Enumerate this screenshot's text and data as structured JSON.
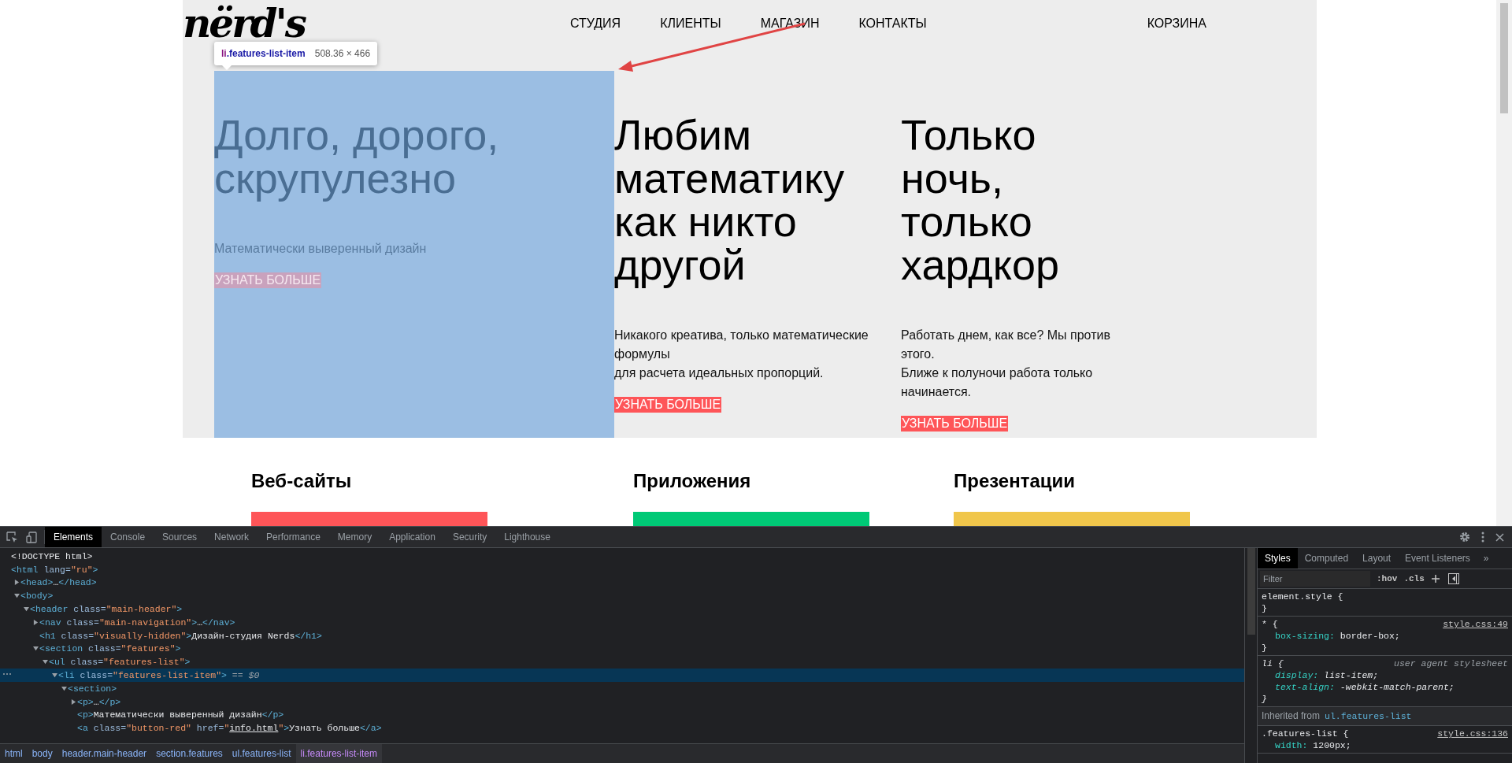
{
  "page": {
    "logo": "nërd's",
    "nav": [
      {
        "label": "СТУДИЯ"
      },
      {
        "label": "КЛИЕНТЫ"
      },
      {
        "label": "МАГАЗИН"
      },
      {
        "label": "КОНТАКТЫ"
      }
    ],
    "cart": "КОРЗИНА",
    "inspect_tooltip": {
      "tag": "li",
      "class_name": ".features-list-item",
      "size": "508.36 × 466"
    },
    "features": [
      {
        "title": "Долго, дорого, скрупулезно",
        "text": "Математически выверенный дизайн",
        "button": "УЗНАТЬ БОЛЬШЕ",
        "highlighted": true
      },
      {
        "title": "Любим математику как никто другой",
        "text": "Никакого креатива, только математические формулы\nдля расчета идеальных пропорций.",
        "button": "УЗНАТЬ БОЛЬШЕ",
        "highlighted": false
      },
      {
        "title": "Только ночь, только хардкор",
        "text": "Работать днем, как все? Мы против этого.\nБлиже к полуночи работа только начинается.",
        "button": "УЗНАТЬ БОЛЬШЕ",
        "highlighted": false
      }
    ],
    "services": [
      {
        "title": "Веб-сайты",
        "color": "#fe5558"
      },
      {
        "title": "Приложения",
        "color": "#00c976"
      },
      {
        "title": "Презентации",
        "color": "#f0c64b"
      }
    ]
  },
  "devtools": {
    "tabs": [
      {
        "label": "Elements",
        "selected": true
      },
      {
        "label": "Console",
        "selected": false
      },
      {
        "label": "Sources",
        "selected": false
      },
      {
        "label": "Network",
        "selected": false
      },
      {
        "label": "Performance",
        "selected": false
      },
      {
        "label": "Memory",
        "selected": false
      },
      {
        "label": "Application",
        "selected": false
      },
      {
        "label": "Security",
        "selected": false
      },
      {
        "label": "Lighthouse",
        "selected": false
      }
    ],
    "dom": [
      {
        "kind": "leaf",
        "selected": false,
        "tokens": [
          {
            "kind": "text",
            "text": "<!DOCTYPE html>"
          }
        ]
      },
      {
        "kind": "root",
        "selected": false,
        "tokens": [
          {
            "kind": "tag",
            "text": "<html"
          },
          {
            "kind": "attr",
            "text": " lang="
          },
          {
            "kind": "value",
            "text": "\"ru\""
          },
          {
            "kind": "tag",
            "text": ">"
          }
        ],
        "children": [
          {
            "kind": "branch",
            "expanded": false,
            "selected": false,
            "tokens": [
              {
                "kind": "tag",
                "text": "<head>"
              },
              {
                "kind": "text",
                "text": "…"
              },
              {
                "kind": "tag",
                "text": "</head>"
              }
            ]
          },
          {
            "kind": "branch",
            "expanded": true,
            "selected": false,
            "tokens": [
              {
                "kind": "tag",
                "text": "<body>"
              }
            ],
            "children": [
              {
                "kind": "branch",
                "expanded": true,
                "selected": false,
                "tokens": [
                  {
                    "kind": "tag",
                    "text": "<header"
                  },
                  {
                    "kind": "attr",
                    "text": " class="
                  },
                  {
                    "kind": "value",
                    "text": "\"main-header\""
                  },
                  {
                    "kind": "tag",
                    "text": ">"
                  }
                ],
                "children": [
                  {
                    "kind": "branch",
                    "expanded": false,
                    "selected": false,
                    "tokens": [
                      {
                        "kind": "tag",
                        "text": "<nav"
                      },
                      {
                        "kind": "attr",
                        "text": " class="
                      },
                      {
                        "kind": "value",
                        "text": "\"main-navigation\""
                      },
                      {
                        "kind": "tag",
                        "text": ">"
                      },
                      {
                        "kind": "text",
                        "text": "…"
                      },
                      {
                        "kind": "tag",
                        "text": "</nav>"
                      }
                    ]
                  },
                  {
                    "kind": "leaf",
                    "selected": false,
                    "tokens": [
                      {
                        "kind": "tag",
                        "text": "<h1"
                      },
                      {
                        "kind": "attr",
                        "text": " class="
                      },
                      {
                        "kind": "value",
                        "text": "\"visually-hidden\""
                      },
                      {
                        "kind": "tag",
                        "text": ">"
                      },
                      {
                        "kind": "text",
                        "text": "Дизайн-студия Nerds"
                      },
                      {
                        "kind": "tag",
                        "text": "</h1>"
                      }
                    ]
                  },
                  {
                    "kind": "branch",
                    "expanded": true,
                    "selected": false,
                    "tokens": [
                      {
                        "kind": "tag",
                        "text": "<section"
                      },
                      {
                        "kind": "attr",
                        "text": " class="
                      },
                      {
                        "kind": "value",
                        "text": "\"features\""
                      },
                      {
                        "kind": "tag",
                        "text": ">"
                      }
                    ],
                    "children": [
                      {
                        "kind": "branch",
                        "expanded": true,
                        "selected": false,
                        "tokens": [
                          {
                            "kind": "tag",
                            "text": "<ul"
                          },
                          {
                            "kind": "attr",
                            "text": " class="
                          },
                          {
                            "kind": "value",
                            "text": "\"features-list\""
                          },
                          {
                            "kind": "tag",
                            "text": ">"
                          }
                        ],
                        "children": [
                          {
                            "kind": "branch",
                            "expanded": true,
                            "selected": true,
                            "tokens": [
                              {
                                "kind": "tag",
                                "text": "<li"
                              },
                              {
                                "kind": "attr",
                                "text": " class="
                              },
                              {
                                "kind": "value",
                                "text": "\"features-list-item\""
                              },
                              {
                                "kind": "tag",
                                "text": ">"
                              },
                              {
                                "kind": "ref",
                                "text": " == $0"
                              }
                            ],
                            "children": [
                              {
                                "kind": "branch",
                                "expanded": true,
                                "selected": false,
                                "tokens": [
                                  {
                                    "kind": "tag",
                                    "text": "<section>"
                                  }
                                ],
                                "children": [
                                  {
                                    "kind": "branch",
                                    "expanded": false,
                                    "selected": false,
                                    "tokens": [
                                      {
                                        "kind": "tag",
                                        "text": "<p>"
                                      },
                                      {
                                        "kind": "text",
                                        "text": "…"
                                      },
                                      {
                                        "kind": "tag",
                                        "text": "</p>"
                                      }
                                    ]
                                  },
                                  {
                                    "kind": "leaf",
                                    "selected": false,
                                    "tokens": [
                                      {
                                        "kind": "tag",
                                        "text": "<p>"
                                      },
                                      {
                                        "kind": "text",
                                        "text": "Математически выверенный дизайн"
                                      },
                                      {
                                        "kind": "tag",
                                        "text": "</p>"
                                      }
                                    ]
                                  },
                                  {
                                    "kind": "leaf",
                                    "selected": false,
                                    "tokens": [
                                      {
                                        "kind": "tag",
                                        "text": "<a"
                                      },
                                      {
                                        "kind": "attr",
                                        "text": " class="
                                      },
                                      {
                                        "kind": "value",
                                        "text": "\"button-red\""
                                      },
                                      {
                                        "kind": "attr",
                                        "text": " href="
                                      },
                                      {
                                        "kind": "value",
                                        "text": "\""
                                      },
                                      {
                                        "kind": "link",
                                        "text": "info.html"
                                      },
                                      {
                                        "kind": "value",
                                        "text": "\""
                                      },
                                      {
                                        "kind": "tag",
                                        "text": ">"
                                      },
                                      {
                                        "kind": "text",
                                        "text": "Узнать больше"
                                      },
                                      {
                                        "kind": "tag",
                                        "text": "</a>"
                                      }
                                    ]
                                  }
                                ]
                              }
                            ]
                          }
                        ]
                      }
                    ]
                  }
                ]
              }
            ]
          }
        ]
      }
    ],
    "breadcrumbs": [
      {
        "label": "html",
        "selected": false
      },
      {
        "label": "body",
        "selected": false
      },
      {
        "label": "header.main-header",
        "selected": false
      },
      {
        "label": "section.features",
        "selected": false
      },
      {
        "label": "ul.features-list",
        "selected": false
      },
      {
        "label": "li.features-list-item",
        "selected": true
      }
    ],
    "styles": {
      "tabs": [
        {
          "label": "Styles",
          "selected": true
        },
        {
          "label": "Computed",
          "selected": false
        },
        {
          "label": "Layout",
          "selected": false
        },
        {
          "label": "Event Listeners",
          "selected": false
        }
      ],
      "more_tabs": "»",
      "filter_placeholder": "Filter",
      "hov": ":hov",
      "cls": ".cls",
      "rules": [
        {
          "kind": "inline",
          "selector": "element.style {",
          "close": "}"
        },
        {
          "kind": "author",
          "selector": "* {",
          "source": "style.css:49",
          "close": "}",
          "properties": [
            {
              "name": "box-sizing:",
              "value": " border-box;"
            }
          ]
        },
        {
          "kind": "user-agent",
          "selector": "li {",
          "source": "user agent stylesheet",
          "close": "}",
          "properties": [
            {
              "name": "display:",
              "value": " list-item;"
            },
            {
              "name": "text-align:",
              "value": " -webkit-match-parent;"
            }
          ]
        },
        {
          "kind": "inherited",
          "label": "Inherited from",
          "selector": "ul.features-list"
        },
        {
          "kind": "author",
          "selector": ".features-list {",
          "source": "style.css:136",
          "properties": [
            {
              "name": "width:",
              "value": " 1200px;"
            }
          ]
        }
      ]
    }
  }
}
